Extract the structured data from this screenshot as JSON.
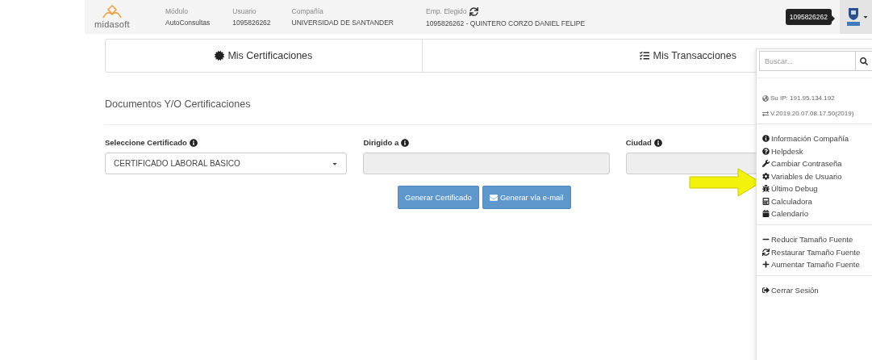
{
  "header": {
    "logo_text": "midasoft",
    "fields": [
      {
        "label": "Módulo",
        "value": "AutoConsultas",
        "kind": "plain"
      },
      {
        "label": "Usuario",
        "value": "1095826262",
        "kind": "plain"
      },
      {
        "label": "Compañía",
        "value": "UNIVERSIDAD DE SANTANDER",
        "kind": "plain"
      },
      {
        "label": "Emp. Elegido",
        "value": "1095826262 - QUINTERO CORZO DANIEL FELIPE",
        "kind": "refreshable"
      }
    ],
    "user_tooltip": "1095826262"
  },
  "tabs": [
    {
      "label": "Mis Certificaciones"
    },
    {
      "label": "Mis Transacciones"
    }
  ],
  "section_title": "Documentos Y/O Certificaciones",
  "form": [
    {
      "label": "Seleccione Certificado",
      "kind": "select",
      "value": "CERTIFICADO LABORAL BASICO",
      "disabled": false
    },
    {
      "label": "Dirigido a",
      "kind": "text",
      "disabled": true
    },
    {
      "label": "Ciudad",
      "kind": "text",
      "disabled": true
    }
  ],
  "buttons": [
    {
      "label": "Generar Certificado"
    },
    {
      "label": "Generar vía e-mail"
    }
  ],
  "user_menu": {
    "search": {
      "placeholder": "Buscar..."
    },
    "groups": [
      [
        {
          "label": "Su IP: 191.95.134.192",
          "kind": "info"
        },
        {
          "label": "V.2019.20.07.08.17.50(2019)",
          "kind": "info"
        }
      ],
      [
        {
          "label": "Información Compañía",
          "kind": "link"
        },
        {
          "label": "Helpdesk",
          "kind": "link"
        },
        {
          "label": "Cambiar Contraseña",
          "kind": "link"
        },
        {
          "label": "Variables de Usuario",
          "kind": "link"
        },
        {
          "label": "Último Debug",
          "kind": "link"
        },
        {
          "label": "Calculadora",
          "kind": "link"
        },
        {
          "label": "Calendario",
          "kind": "link"
        }
      ],
      [
        {
          "label": "Reducir Tamaño Fuente",
          "kind": "link"
        },
        {
          "label": "Restaurar Tamaño Fuente",
          "kind": "link"
        },
        {
          "label": "Aumentar Tamaño Fuente",
          "kind": "link"
        }
      ],
      [
        {
          "label": "Cerrar Sesión",
          "kind": "link"
        }
      ]
    ]
  }
}
